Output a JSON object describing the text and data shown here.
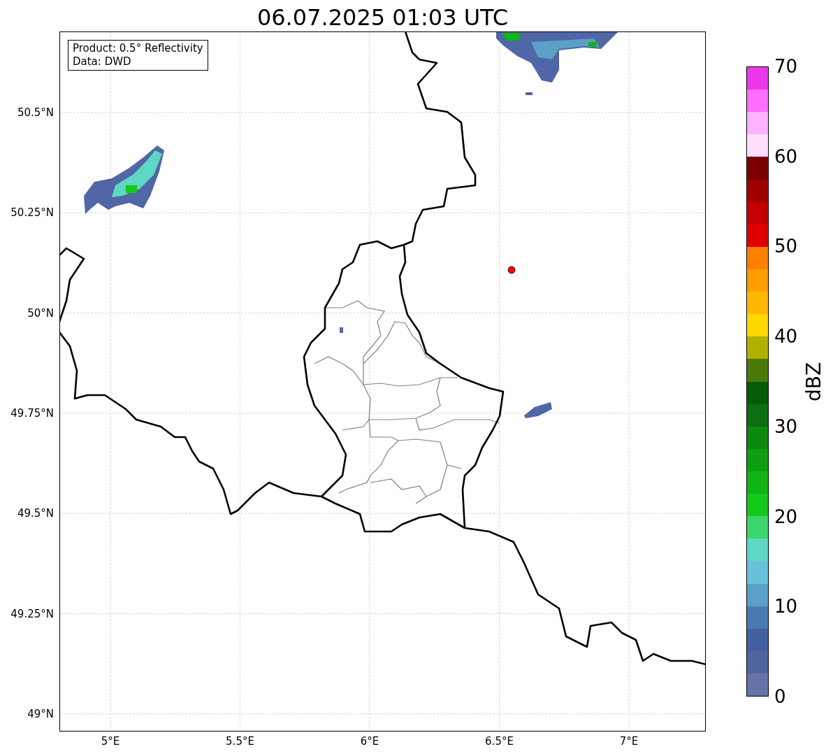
{
  "title": "06.07.2025 01:03 UTC",
  "info_box": {
    "lines": [
      "Product: 0.5° Reflectivity",
      "Data: DWD"
    ]
  },
  "map": {
    "lat_ticks": [
      "50.5°N",
      "50.25°N",
      "50°N",
      "49.75°N",
      "49.5°N",
      "49.25°N",
      "49°N"
    ],
    "lon_ticks": [
      "5°E",
      "5.5°E",
      "6°E",
      "6.5°E",
      "7°E"
    ]
  },
  "colorbar": {
    "label": "dBZ",
    "ticks": [
      "70",
      "60",
      "50",
      "40",
      "30",
      "20",
      "10",
      "0"
    ],
    "bins": [
      {
        "color": "#ee36ee"
      },
      {
        "color": "#ff6eff"
      },
      {
        "color": "#ffb3ff"
      },
      {
        "color": "#ffe0ff"
      },
      {
        "color": "#7a0000"
      },
      {
        "color": "#a00000"
      },
      {
        "color": "#c40000"
      },
      {
        "color": "#e00000"
      },
      {
        "color": "#ff7f00"
      },
      {
        "color": "#ff9c00"
      },
      {
        "color": "#ffb800"
      },
      {
        "color": "#ffd800"
      },
      {
        "color": "#b0b000"
      },
      {
        "color": "#487a08"
      },
      {
        "color": "#065c06"
      },
      {
        "color": "#0a7010"
      },
      {
        "color": "#0b8a0e"
      },
      {
        "color": "#0e9e12"
      },
      {
        "color": "#10b414"
      },
      {
        "color": "#12c818"
      },
      {
        "color": "#3ad66a"
      },
      {
        "color": "#5ed8c4"
      },
      {
        "color": "#66c2dc"
      },
      {
        "color": "#5aa0c8"
      },
      {
        "color": "#4a7ab4"
      },
      {
        "color": "#4060a0"
      },
      {
        "color": "#50649e"
      },
      {
        "color": "#6473a8"
      }
    ]
  }
}
